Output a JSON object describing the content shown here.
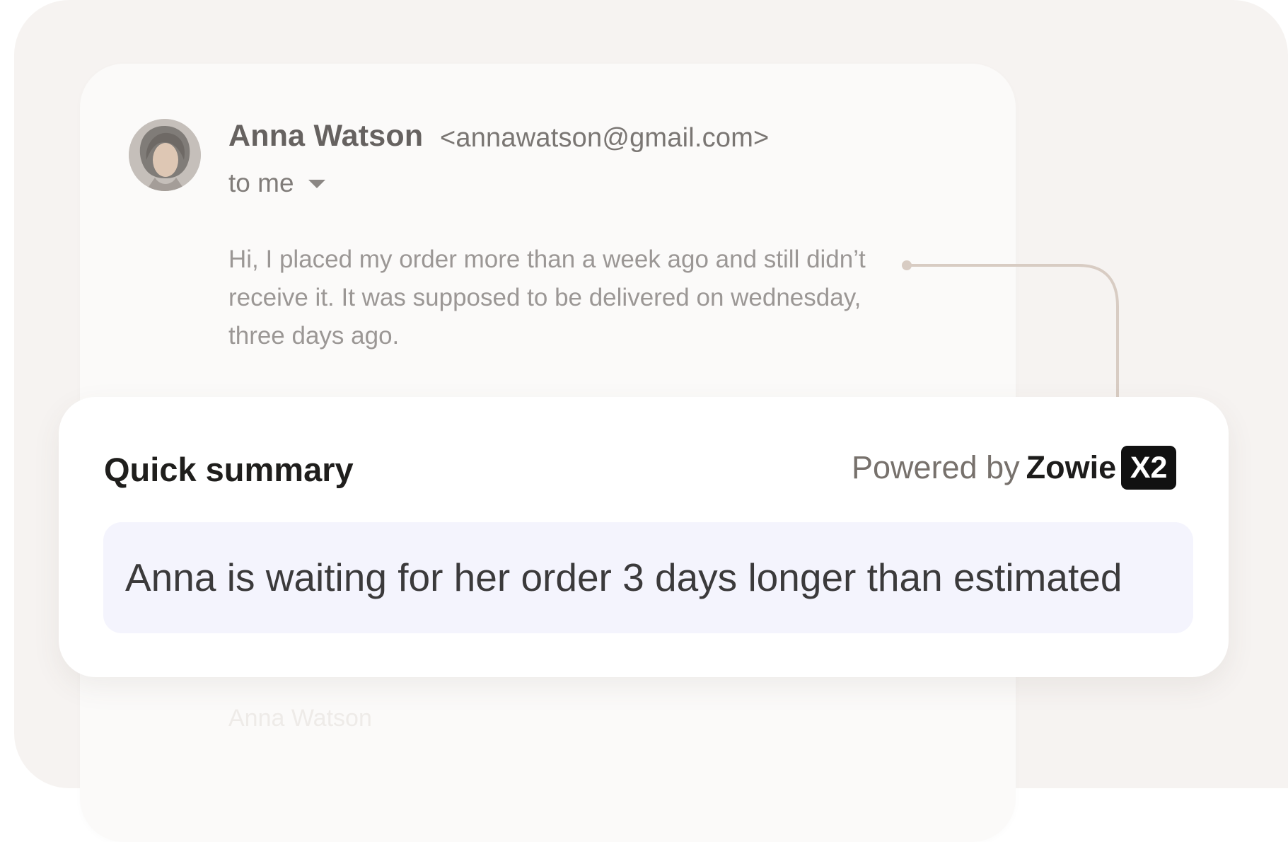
{
  "email": {
    "sender_name": "Anna Watson",
    "sender_email": "<annawatson@gmail.com>",
    "recipient": "to me",
    "message": "Hi, I placed my order more than a week ago and still didn’t receive it. It was supposed to be delivered on wednesday, three days ago.",
    "faded_signature": "Anna Watson",
    "avatar_icon": "person-photo",
    "dropdown_icon": "chevron-down-icon"
  },
  "summary": {
    "title": "Quick summary",
    "powered_label": "Powered by",
    "brand_name": "Zowie",
    "brand_badge": "X2",
    "text": "Anna is waiting for her order 3 days longer than estimated"
  },
  "colors": {
    "canvas": "#f6f3f1",
    "email_card": "#fbfaf9",
    "summary_card": "#ffffff",
    "summary_box": "#f4f4fd",
    "connector": "#d8ccc3"
  }
}
